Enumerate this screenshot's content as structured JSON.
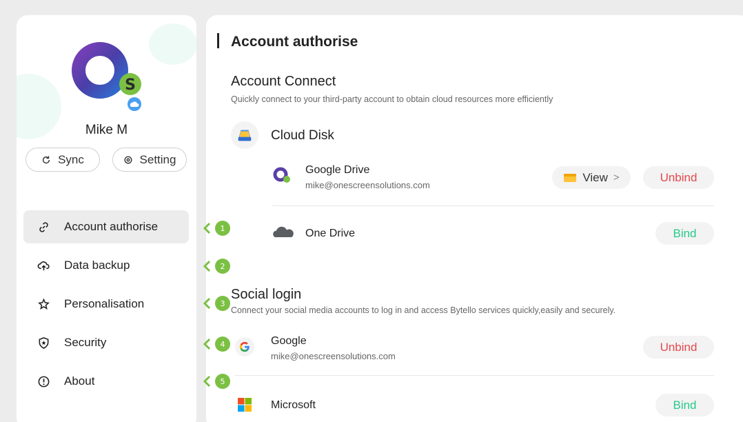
{
  "user": {
    "name": "Mike M"
  },
  "profile_buttons": {
    "sync_label": "Sync",
    "setting_label": "Setting"
  },
  "sidebar": {
    "items": [
      {
        "label": "Account authorise",
        "icon": "link-icon",
        "active": true
      },
      {
        "label": "Data backup",
        "icon": "cloud-upload-icon",
        "active": false
      },
      {
        "label": "Personalisation",
        "icon": "star-sparkle-icon",
        "active": false
      },
      {
        "label": "Security",
        "icon": "shield-icon",
        "active": false
      },
      {
        "label": "About",
        "icon": "info-icon",
        "active": false
      }
    ]
  },
  "markers": [
    "1",
    "2",
    "3",
    "4",
    "5"
  ],
  "main": {
    "title": "Account authorise",
    "account_connect": {
      "title": "Account Connect",
      "subtitle": "Quickly connect to your third-party account to obtain cloud resources more efficiently",
      "category": "Cloud Disk",
      "accounts": [
        {
          "name": "Google Drive",
          "email": "mike@onescreensolutions.com",
          "view_label": "View",
          "action": "Unbind"
        },
        {
          "name": "One Drive",
          "email": "",
          "action": "Bind"
        }
      ]
    },
    "social_login": {
      "title": "Social login",
      "subtitle": "Connect your social media accounts to log in and access Bytello services quickly,easily and securely.",
      "accounts": [
        {
          "name": "Google",
          "email": "mike@onescreensolutions.com",
          "action": "Unbind"
        },
        {
          "name": "Microsoft",
          "email": "",
          "action": "Bind"
        }
      ]
    }
  },
  "colors": {
    "unbind": "#e5484d",
    "bind": "#27c98a",
    "marker": "#7bc043",
    "active_nav": "#ececec"
  }
}
